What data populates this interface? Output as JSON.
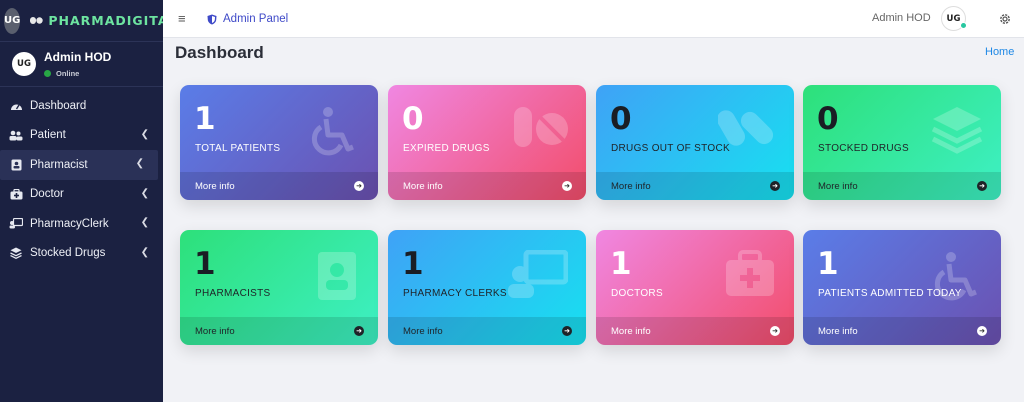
{
  "brand": {
    "logo_text": "UG",
    "name": "PHARMADIGITAL"
  },
  "user_panel": {
    "avatar_text": "UG",
    "name": "Admin HOD",
    "status": "Online"
  },
  "menu": [
    {
      "label": "Dashboard",
      "icon": "dashboard-icon",
      "has_children": false,
      "active": false
    },
    {
      "label": "Patient",
      "icon": "users-icon",
      "has_children": true,
      "active": false
    },
    {
      "label": "Pharmacist",
      "icon": "user-card-icon",
      "has_children": true,
      "active": true
    },
    {
      "label": "Doctor",
      "icon": "medkit-icon",
      "has_children": true,
      "active": false
    },
    {
      "label": "PharmacyClerk",
      "icon": "clerk-icon",
      "has_children": true,
      "active": false
    },
    {
      "label": "Stocked Drugs",
      "icon": "layers-icon",
      "has_children": true,
      "active": false
    }
  ],
  "header": {
    "menu_toggle": "≡",
    "panel_label": "Admin Panel",
    "user_name": "Admin HOD",
    "avatar_text": "UG"
  },
  "page": {
    "title": "Dashboard",
    "breadcrumb": "Home"
  },
  "cards": [
    {
      "count": "1",
      "label": "TOTAL PATIENTS",
      "footer": "More info",
      "icon": "wheelchair-icon"
    },
    {
      "count": "0",
      "label": "EXPIRED DRUGS",
      "footer": "More info",
      "icon": "pills-icon"
    },
    {
      "count": "0",
      "label": "DRUGS OUT OF STOCK",
      "footer": "More info",
      "icon": "capsules-icon"
    },
    {
      "count": "0",
      "label": "STOCKED DRUGS",
      "footer": "More info",
      "icon": "layers-icon"
    },
    {
      "count": "1",
      "label": "PHARMACISTS",
      "footer": "More info",
      "icon": "address-book-icon"
    },
    {
      "count": "1",
      "label": "PHARMACY CLERKS",
      "footer": "More info",
      "icon": "chalkboard-teacher-icon"
    },
    {
      "count": "1",
      "label": "DOCTORS",
      "footer": "More info",
      "icon": "medkit-icon"
    },
    {
      "count": "1",
      "label": "PATIENTS ADMITTED TODAY",
      "footer": "More info",
      "icon": "wheelchair-icon"
    }
  ],
  "colors": {
    "sidebar": "#1b2141",
    "brand": "#6de4a0",
    "link": "#3f4ac8",
    "status_online": "#28a745"
  }
}
